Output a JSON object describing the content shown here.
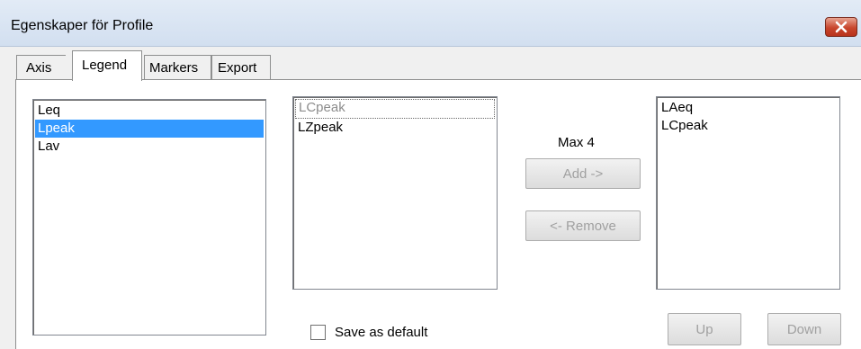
{
  "window": {
    "title": "Egenskaper för Profile",
    "close_icon": "close-icon"
  },
  "tabs": [
    {
      "label": "Axis",
      "active": false
    },
    {
      "label": "Legend",
      "active": true
    },
    {
      "label": "Markers",
      "active": false
    },
    {
      "label": "Export",
      "active": false
    }
  ],
  "lists": {
    "available_params": {
      "items": [
        "Leq",
        "Lpeak",
        "Lav"
      ],
      "selected": "Lpeak"
    },
    "available_channels": {
      "items": [
        "LCpeak",
        "LZpeak"
      ],
      "focused": "LCpeak"
    },
    "selected_legend": {
      "items": [
        "LAeq",
        "LCpeak"
      ]
    }
  },
  "max_label": "Max 4",
  "buttons": {
    "add": "Add ->",
    "remove": "<- Remove",
    "up": "Up",
    "down": "Down"
  },
  "save_default": {
    "label": "Save as default",
    "checked": false
  },
  "colors": {
    "selection": "#3399ff",
    "close_button": "#c8462d"
  }
}
